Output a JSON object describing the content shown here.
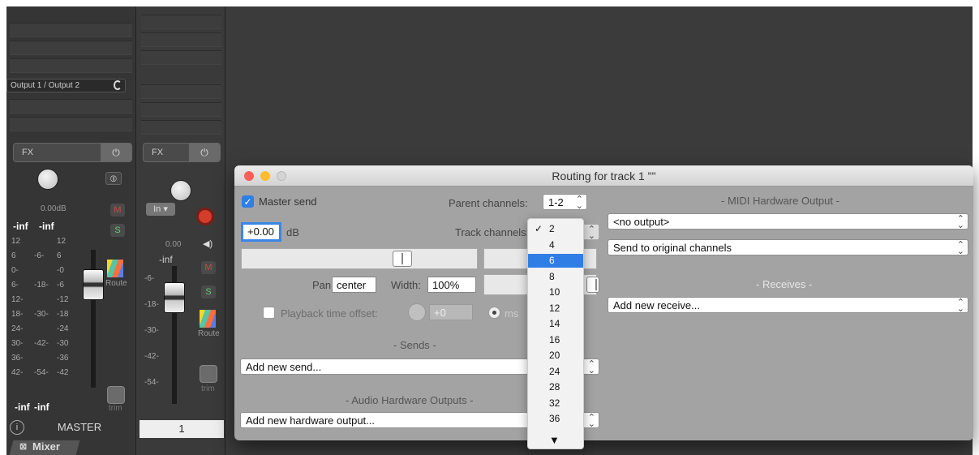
{
  "mixer": {
    "master": {
      "output_label": "Output 1 / Output 2",
      "fx_label": "FX",
      "power_glyph": "⏻",
      "stereo_glyph": "⦶",
      "volume_db": "0.00dB",
      "mute": "M",
      "solo": "S",
      "peak_left": "-inf",
      "peak_right": "-inf",
      "route_label": "Route",
      "trim_label": "trim",
      "scale_left": [
        "12",
        "6",
        "0-",
        "6-",
        "12-",
        "18-",
        "24-",
        "30-",
        "36-",
        "42-"
      ],
      "scale_right": [
        "12",
        "6",
        "-0",
        "-6",
        "-12",
        "-18",
        "-24",
        "-30",
        "-36",
        "-42"
      ],
      "scale_mid": [
        "-6-",
        "-18-",
        "-30-",
        "-42-",
        "-54-"
      ],
      "peak_bottom_left": "-inf",
      "peak_bottom_right": "-inf",
      "info_glyph": "i",
      "name": "MASTER"
    },
    "track": {
      "fx_label": "FX",
      "power_glyph": "⏻",
      "in_label": "In",
      "volume_db": "0.00",
      "speaker_glyph": "◀)",
      "mute": "M",
      "solo": "S",
      "peak": "-inf",
      "scale": [
        "-6-",
        "-18-",
        "-30-",
        "-42-",
        "-54-"
      ],
      "route_label": "Route",
      "trim_label": "trim",
      "number": "1"
    },
    "tab_label": "Mixer",
    "tab_bang": "!",
    "tab_close": "⊠"
  },
  "dialog": {
    "title": "Routing for track 1 \"\"",
    "master_send_label": "Master send",
    "master_send_checked": true,
    "parent_channels_label": "Parent channels:",
    "parent_channels_value": "1-2",
    "volume_value": "+0.00",
    "db_label": "dB",
    "track_channels_label": "Track channels:",
    "pan_label": "Pan:",
    "pan_value": "center",
    "width_label": "Width:",
    "width_value": "100%",
    "playback_offset_label": "Playback time offset:",
    "playback_offset_value": "+0",
    "ms_label": "ms",
    "sends_header": "- Sends -",
    "add_send": "Add new send...",
    "audio_hw_header": "- Audio Hardware Outputs -",
    "add_hw_output": "Add new hardware output...",
    "midi_hw_header": "- MIDI Hardware Output -",
    "midi_output": "<no output>",
    "midi_channels": "Send to original channels",
    "receives_header": "- Receives -",
    "add_receive": "Add new receive...",
    "updown_glyph": "⌃⌄"
  },
  "channel_menu": {
    "items": [
      "2",
      "4",
      "6",
      "8",
      "10",
      "12",
      "14",
      "16",
      "20",
      "24",
      "28",
      "32",
      "36"
    ],
    "checked": "2",
    "selected": "6",
    "check_glyph": "✓",
    "more_glyph": "▼"
  },
  "colors": {
    "accent": "#2f7ee5",
    "close": "#fc5f57",
    "minimize": "#fdbc2e",
    "mute_red": "#c94a3e",
    "solo_green": "#5fd068",
    "record_red": "#d43c2c"
  }
}
